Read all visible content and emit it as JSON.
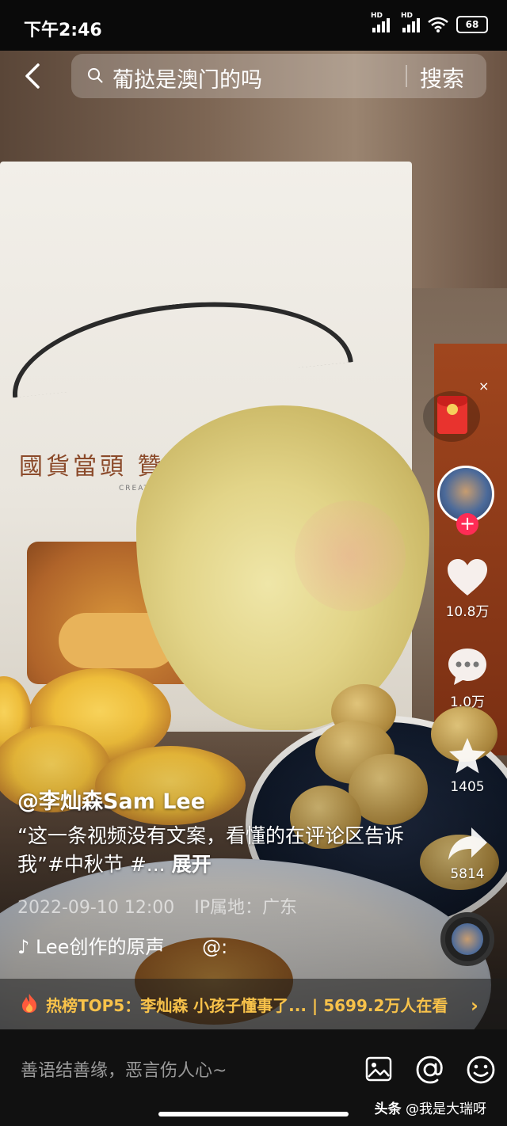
{
  "status_bar": {
    "time": "下午2:46",
    "network_label_1": "HD",
    "network_label_2": "HD",
    "battery": "68"
  },
  "search": {
    "query": "葡挞是澳门的吗",
    "button_label": "搜索"
  },
  "video_text": {
    "bag_slogan": "國貨當頭  贊不絕口",
    "bag_subtitle": "CREATION OF CHINA"
  },
  "actions": {
    "redpacket_close": "×",
    "follow_plus": "+",
    "like_count": "10.8万",
    "comment_count": "1.0万",
    "favorite_count": "1405",
    "share_count": "5814"
  },
  "post": {
    "author": "@李灿森Sam Lee",
    "caption": "“这一条视频没有文案，看懂的在评论区告诉我”#中秋节 #...",
    "expand_label": "展开",
    "datetime": "2022-09-10 12:00",
    "ip_location": "IP属地：广东",
    "music_note": "♪",
    "music": "Lee创作的原声",
    "music_at": "@:"
  },
  "hot_banner": {
    "text": "热榜TOP5：李灿森 小孩子懂事了... | 5699.2万人在看",
    "arrow": "›"
  },
  "comment_bar": {
    "placeholder": "善语结善缘，恶言伤人心~"
  },
  "watermark": {
    "brand": "头条",
    "account": "@我是大瑞呀"
  },
  "colors": {
    "accent_red": "#fe2c55",
    "hot_gold": "#f8c24a"
  }
}
